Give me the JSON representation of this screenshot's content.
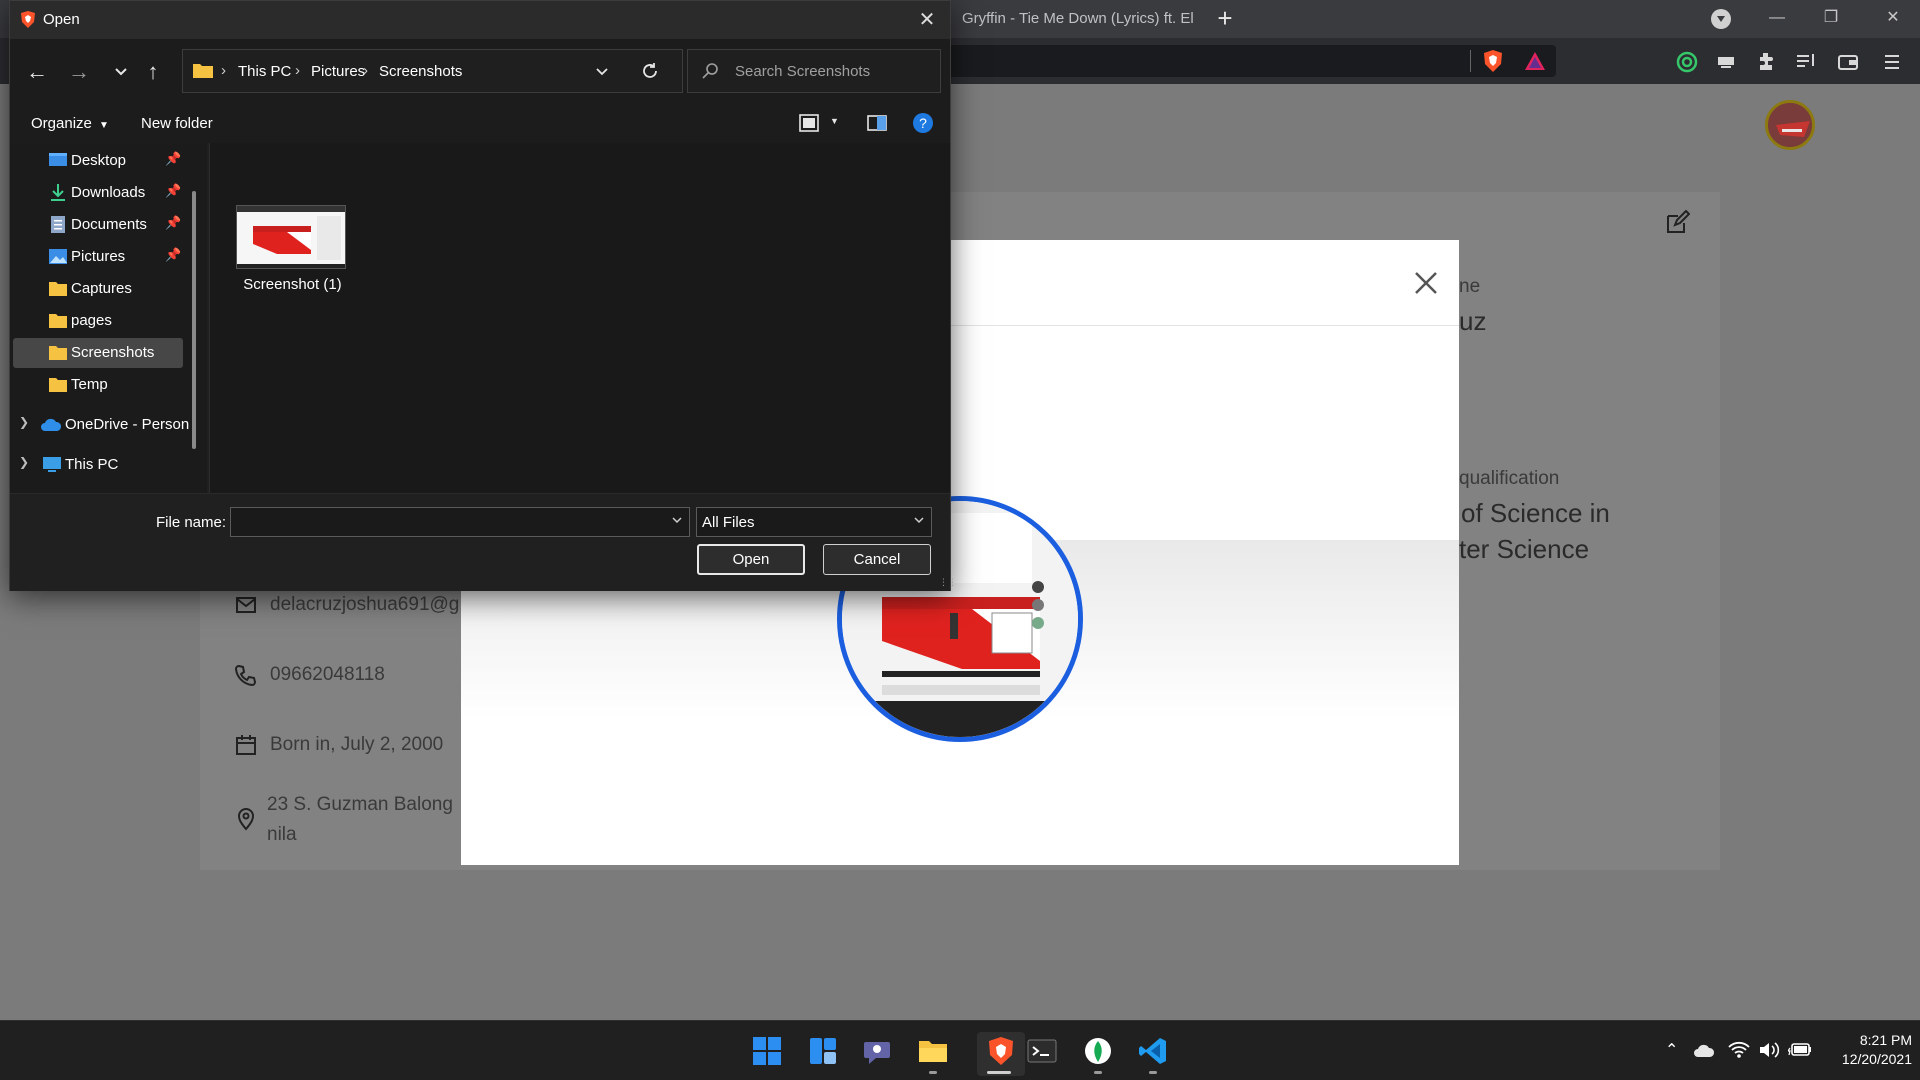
{
  "browser": {
    "tab_title": "Gryffin - Tie Me Down (Lyrics) ft. El",
    "new_tab_label": "+"
  },
  "page": {
    "header_label_fragment": "ne",
    "name_fragment": "uz",
    "qualification_label": "qualification",
    "qualification_line1": "of Science in",
    "qualification_line2": "ter Science",
    "email": "delacruzjoshua691@g",
    "phone": "09662048118",
    "birth": "Born in, July 2, 2000",
    "address_line1": "23 S. Guzman Balong",
    "address_line2": "nila"
  },
  "dialog": {
    "title": "Open",
    "breadcrumb": [
      "This PC",
      "Pictures",
      "Screenshots"
    ],
    "search_placeholder": "Search Screenshots",
    "organize_label": "Organize",
    "new_folder_label": "New folder",
    "nav_items": [
      {
        "label": "Desktop",
        "icon": "desktop-icon",
        "pinned": true
      },
      {
        "label": "Downloads",
        "icon": "download-icon",
        "pinned": true
      },
      {
        "label": "Documents",
        "icon": "document-icon",
        "pinned": true
      },
      {
        "label": "Pictures",
        "icon": "pictures-icon",
        "pinned": true
      },
      {
        "label": "Captures",
        "icon": "folder-icon",
        "pinned": false
      },
      {
        "label": "pages",
        "icon": "folder-icon",
        "pinned": false
      },
      {
        "label": "Screenshots",
        "icon": "folder-icon",
        "pinned": false,
        "selected": true
      },
      {
        "label": "Temp",
        "icon": "folder-icon",
        "pinned": false
      },
      {
        "label": "OneDrive - Person",
        "icon": "cloud-icon",
        "pinned": false
      },
      {
        "label": "This PC",
        "icon": "pc-icon",
        "pinned": false
      }
    ],
    "files": [
      {
        "name": "Screenshot (1)"
      }
    ],
    "file_name_label": "File name:",
    "file_name_value": "",
    "file_type": "All Files",
    "open_label": "Open",
    "cancel_label": "Cancel"
  },
  "taskbar": {
    "time": "8:21 PM",
    "date": "12/20/2021"
  },
  "colors": {
    "dialog_bg": "#202020",
    "modal_accent": "#1b5fe0",
    "brave_orange": "#fb542b",
    "folder_yellow": "#f5c242"
  }
}
